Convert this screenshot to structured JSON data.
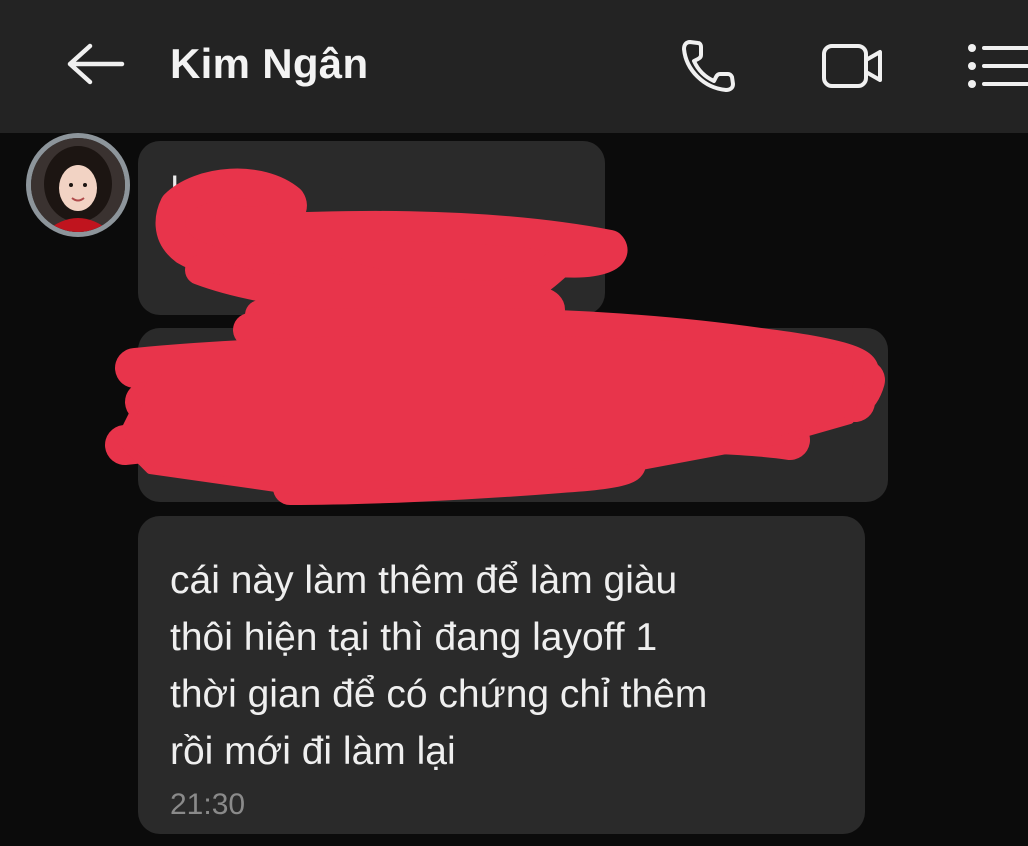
{
  "header": {
    "contact_name": "Kim Ngân",
    "back_icon": "arrow-left-icon",
    "call_icon": "phone-icon",
    "video_icon": "video-camera-icon",
    "menu_icon": "list-menu-icon"
  },
  "messages": [
    {
      "text": "I",
      "redacted": true
    },
    {
      "text": "",
      "redacted": true
    },
    {
      "text": "cái này làm thêm để làm giàu\nthôi hiện tại thì đang layoff 1\nthời gian để có chứng chỉ thêm\nrồi mới đi làm lại",
      "time": "21:30",
      "redacted": false
    }
  ],
  "colors": {
    "background": "#0b0b0b",
    "header": "#232323",
    "bubble": "#2a2a2a",
    "redaction": "#e8344b",
    "timestamp": "#8a8a8a"
  }
}
